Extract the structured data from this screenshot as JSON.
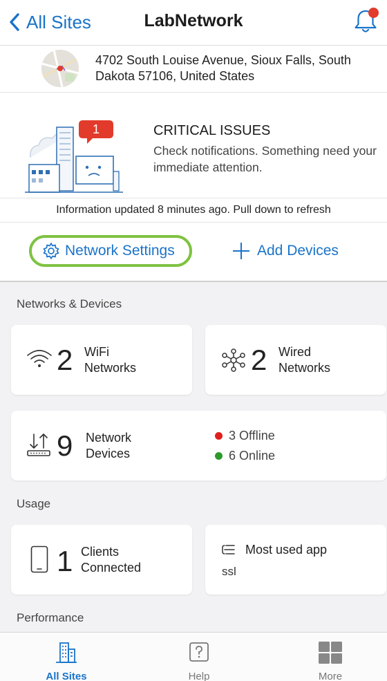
{
  "header": {
    "back_label": "All Sites",
    "title": "LabNetwork",
    "bell_icon": "bell-icon"
  },
  "site": {
    "address": "4702 South Louise Avenue, Sioux Falls, South Dakota 57106, United States"
  },
  "critical": {
    "badge_count": "1",
    "title": "CRITICAL ISSUES",
    "description": "Check notifications. Something need your immediate attention."
  },
  "info_text": "Information updated 8 minutes ago. Pull down to refresh",
  "actions": {
    "network_settings": "Network Settings",
    "add_devices": "Add Devices"
  },
  "sections": {
    "networks_devices": "Networks & Devices",
    "usage": "Usage",
    "performance": "Performance"
  },
  "cards": {
    "wifi": {
      "count": "2",
      "line1": "WiFi",
      "line2": "Networks"
    },
    "wired": {
      "count": "2",
      "line1": "Wired",
      "line2": "Networks"
    },
    "devices": {
      "count": "9",
      "line1": "Network",
      "line2": "Devices",
      "offline": "3 Offline",
      "online": "6 Online"
    },
    "clients": {
      "count": "1",
      "line1": "Clients",
      "line2": "Connected"
    },
    "app": {
      "title": "Most used app",
      "value": "ssl"
    }
  },
  "tabs": [
    {
      "label": "All Sites",
      "active": true
    },
    {
      "label": "Help",
      "active": false
    },
    {
      "label": "More",
      "active": false
    }
  ],
  "colors": {
    "accent": "#1a73c9",
    "highlight": "#7ec242",
    "offline": "#e0201b",
    "online": "#2c9a2c",
    "alert": "#e23a2b"
  }
}
